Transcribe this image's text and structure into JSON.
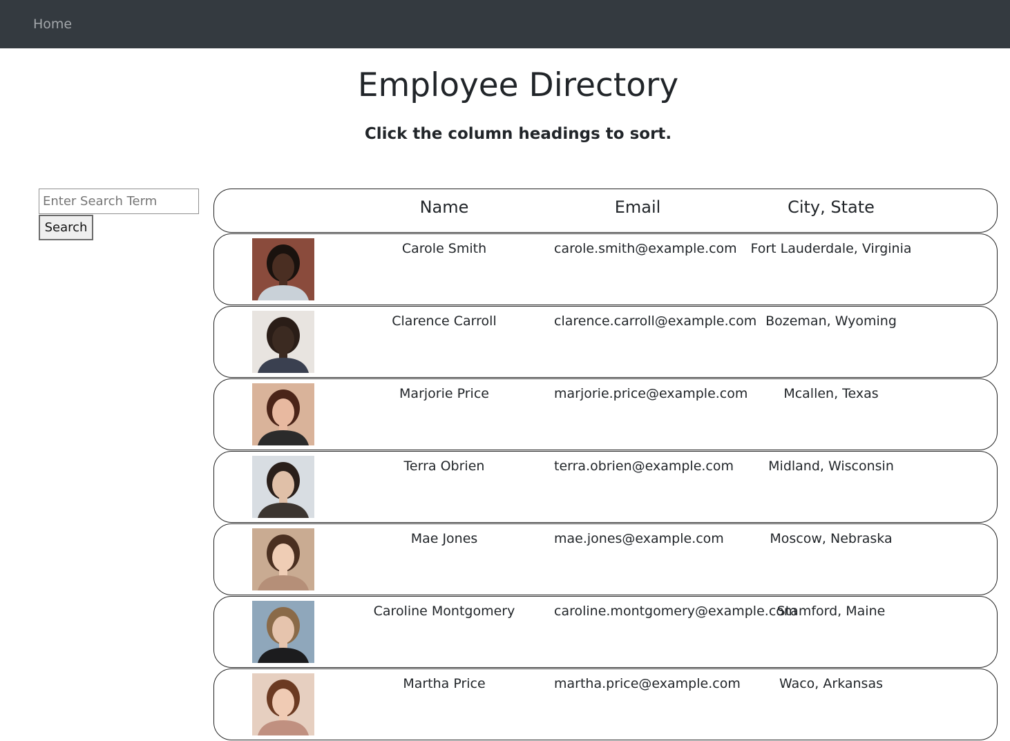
{
  "nav": {
    "home_label": "Home"
  },
  "page": {
    "title": "Employee Directory",
    "subtitle": "Click the column headings to sort."
  },
  "search": {
    "placeholder": "Enter Search Term",
    "value": "",
    "button_label": "Search"
  },
  "table": {
    "headers": {
      "image": "",
      "name": "Name",
      "email": "Email",
      "city_state": "City, State"
    },
    "rows": [
      {
        "name": "Carole Smith",
        "email": "carole.smith@example.com",
        "city_state": "Fort Lauderdale, Virginia",
        "photo": {
          "bg": "#8a4b3c",
          "skin": "#4a2e22",
          "hair": "#1a120e",
          "shirt": "#c9d1d8"
        }
      },
      {
        "name": "Clarence Carroll",
        "email": "clarence.carroll@example.com",
        "city_state": "Bozeman, Wyoming",
        "photo": {
          "bg": "#e8e4e0",
          "skin": "#3b2a21",
          "hair": "#2a1d17",
          "shirt": "#3a4050"
        }
      },
      {
        "name": "Marjorie Price",
        "email": "marjorie.price@example.com",
        "city_state": "Mcallen, Texas",
        "photo": {
          "bg": "#d9b39a",
          "skin": "#e8b9a0",
          "hair": "#4a2418",
          "shirt": "#2b2b2b"
        }
      },
      {
        "name": "Terra Obrien",
        "email": "terra.obrien@example.com",
        "city_state": "Midland, Wisconsin",
        "photo": {
          "bg": "#d8dde2",
          "skin": "#e0c0a8",
          "hair": "#2a1f1a",
          "shirt": "#3c3530"
        }
      },
      {
        "name": "Mae Jones",
        "email": "mae.jones@example.com",
        "city_state": "Moscow, Nebraska",
        "photo": {
          "bg": "#c9ab92",
          "skin": "#efcdb5",
          "hair": "#4a2f20",
          "shirt": "#b58f78"
        }
      },
      {
        "name": "Caroline Montgomery",
        "email": "caroline.montgomery@example.com",
        "city_state": "Stamford, Maine",
        "photo": {
          "bg": "#8fa7bb",
          "skin": "#e6c4ad",
          "hair": "#8a6a48",
          "shirt": "#1c1c1e"
        }
      },
      {
        "name": "Martha Price",
        "email": "martha.price@example.com",
        "city_state": "Waco, Arkansas",
        "photo": {
          "bg": "#e6cfc0",
          "skin": "#f0cbb4",
          "hair": "#6b3a22",
          "shirt": "#c09080"
        }
      }
    ]
  }
}
